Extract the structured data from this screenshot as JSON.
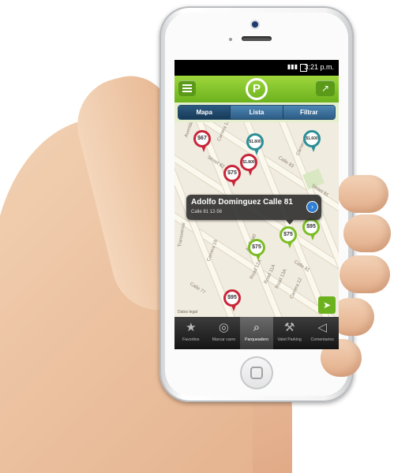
{
  "status_bar": {
    "signal": "▮▮▮",
    "time": "3:21 p.m."
  },
  "app_bar": {
    "logo_letter": "P",
    "menu_icon": "menu-icon",
    "share_icon": "share-icon"
  },
  "view_tabs": [
    {
      "label": "Mapa",
      "active": true
    },
    {
      "label": "Lista",
      "active": false
    },
    {
      "label": "Filtrar",
      "active": false
    }
  ],
  "map": {
    "streets": [
      "Avenida",
      "Carrera 19",
      "Carrera 13",
      "Calle 83",
      "Street 82",
      "Street 81",
      "Transversal",
      "Carrera 16",
      "Av Road",
      "Road 12A",
      "Road 11A",
      "Road 13A",
      "Carrera 12",
      "Calle 81",
      "Calle 77"
    ],
    "pins": [
      {
        "label": "$67",
        "color": "red"
      },
      {
        "label": "$1.800",
        "color": "teal"
      },
      {
        "label": "$1.800",
        "color": "red"
      },
      {
        "label": "$1.600",
        "color": "teal"
      },
      {
        "label": "$75",
        "color": "red"
      },
      {
        "label": "$75",
        "color": "green"
      },
      {
        "label": "$95",
        "color": "green"
      },
      {
        "label": "$75",
        "color": "green"
      },
      {
        "label": "$95",
        "color": "red"
      }
    ],
    "callout": {
      "title": "Adolfo Dominguez Calle 81",
      "subtitle": "Calle 81 12-56"
    },
    "legal": "Datos legal"
  },
  "bottom_tabs": [
    {
      "label": "Favoritos",
      "icon": "star-icon",
      "glyph": "★",
      "active": false
    },
    {
      "label": "Marcar carro",
      "icon": "compass-icon",
      "glyph": "◎",
      "active": false
    },
    {
      "label": "Parqueadero",
      "icon": "magnifier-icon",
      "glyph": "⌕",
      "active": true
    },
    {
      "label": "Valet Parking",
      "icon": "wrench-icon",
      "glyph": "⚒",
      "active": false
    },
    {
      "label": "Comentarios",
      "icon": "megaphone-icon",
      "glyph": "◁",
      "active": false
    }
  ]
}
